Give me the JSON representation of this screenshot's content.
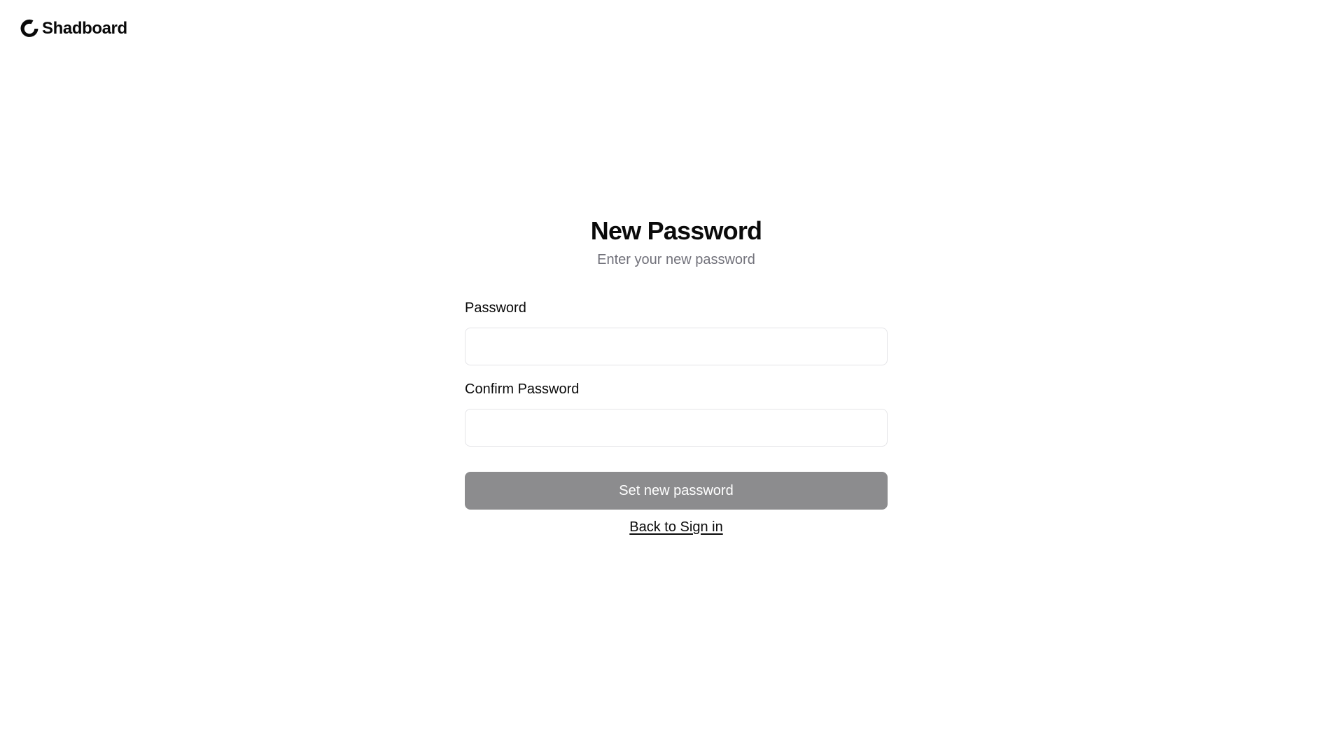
{
  "brand": {
    "name": "Shadboard",
    "icon": "shadboard-logo-icon"
  },
  "heading": {
    "title": "New Password",
    "subtitle": "Enter your new password"
  },
  "form": {
    "password": {
      "label": "Password",
      "value": "",
      "placeholder": ""
    },
    "confirm_password": {
      "label": "Confirm Password",
      "value": "",
      "placeholder": ""
    },
    "submit_label": "Set new password",
    "back_link_label": "Back to Sign in"
  },
  "colors": {
    "background": "#ffffff",
    "text": "#0a0a0a",
    "muted_text": "#71717a",
    "input_border": "#e4e4e7",
    "button_disabled": "#8c8c8e",
    "button_text": "#ffffff"
  }
}
